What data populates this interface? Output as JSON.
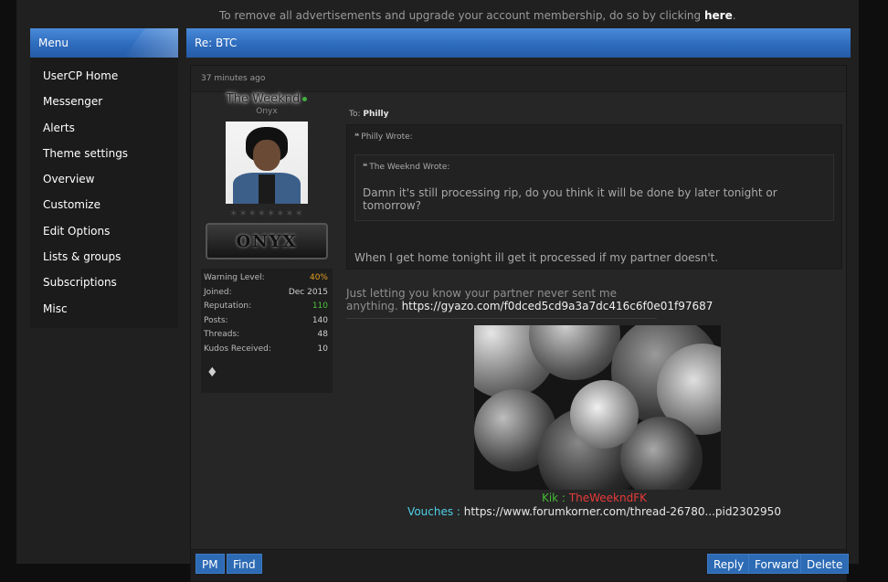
{
  "notice": {
    "text": "To remove all advertisements and upgrade your account membership, do so by clicking ",
    "link": "here",
    "end": "."
  },
  "menu": {
    "title": "Menu",
    "items": [
      "UserCP Home",
      "Messenger",
      "Alerts",
      "Theme settings",
      "Overview",
      "Customize",
      "Edit Options",
      "Lists & groups",
      "Subscriptions",
      "Misc"
    ]
  },
  "thread": {
    "title": "Re: BTC"
  },
  "post": {
    "date": "37 minutes ago",
    "author": {
      "name": "The Weeknd",
      "title": "Onyx",
      "stars": "✶✶✶✶✶✶✶✶",
      "rank_label": "ONYX",
      "stats": [
        {
          "label": "Warning Level:",
          "value": "40%"
        },
        {
          "label": "Joined:",
          "value": "Dec 2015"
        },
        {
          "label": "Reputation:",
          "value": "110"
        },
        {
          "label": "Posts:",
          "value": "140"
        },
        {
          "label": "Threads:",
          "value": "48"
        },
        {
          "label": "Kudos Received:",
          "value": "10"
        }
      ],
      "badge": "♦"
    },
    "to_label": "To: ",
    "to_user": "Philly",
    "outer_quote": {
      "head": "Philly Wrote:",
      "text": "When I get home tonight ill get it processed if my partner doesn't."
    },
    "inner_quote": {
      "head": "The Weeknd Wrote:",
      "text": "Damn it's still processing rip, do you think it will be done by later tonight or tomorrow?"
    },
    "message_line1": "Just letting you know your partner never sent me",
    "message_line2": "anything.",
    "message_link": "https://gyazo.com/f0dced5cd9a3a7dc416c6f0e01f97687",
    "signature": {
      "kik_label": "Kik :",
      "kik_value": "TheWeekndFK",
      "vouches_label": "Vouches :",
      "vouches_value": "https://www.forumkorner.com/thread-26780...pid2302950"
    },
    "buttons": {
      "pm": "PM",
      "find": "Find",
      "reply": "Reply",
      "forward": "Forward",
      "delete": "Delete"
    }
  },
  "colors": {
    "accent": "#2e6bbd",
    "kik_label": "#43b933",
    "kik_value": "#e83a3a",
    "vouches": "#4fd0e8"
  }
}
